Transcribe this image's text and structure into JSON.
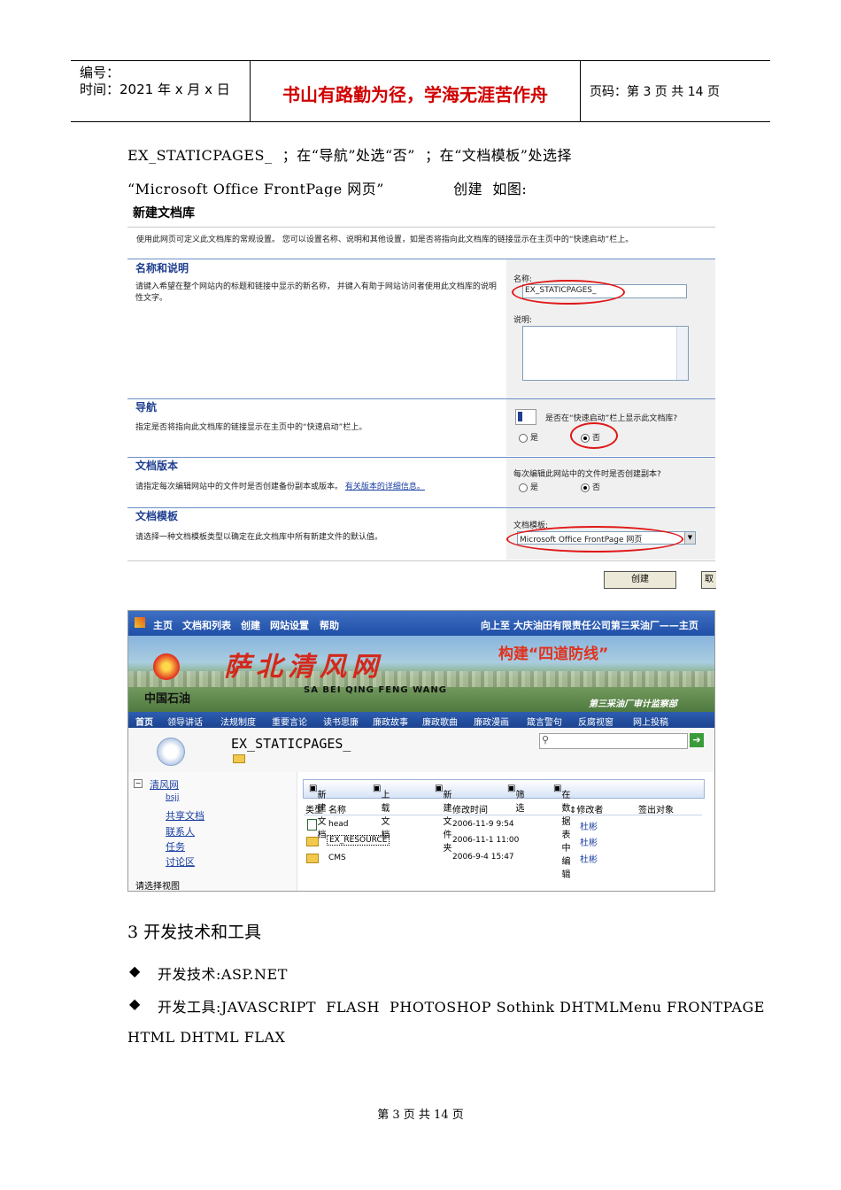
{
  "header": {
    "number_label": "编号：",
    "time_label": "时间：2021 年 x 月 x 日",
    "motto": "书山有路勤为径，学海无涯苦作舟",
    "page_label": "页码：第 3 页  共 14 页"
  },
  "intro": {
    "line1": "EX_STATICPAGES_  ；在“导航”处选“否”  ；在“文档模板”处选择",
    "line2": "“Microsoft Office FrontPage 网页”              创建  如图:"
  },
  "shot1": {
    "title": "新建文档库",
    "desc": "使用此网页可定义此文档库的常规设置。 您可以设置名称、说明和其他设置，如是否将指向此文档库的链接显示在主页中的“快速启动”栏上。",
    "sec1_title": "名称和说明",
    "sec1_desc": "请键入希望在整个网站内的标题和链接中显示的新名称， 并键入有助于网站访问者使用此文档库的说明性文字。",
    "name_label": "名称:",
    "name_value": "EX_STATICPAGES_",
    "desc_label": "说明:",
    "sec2_title": "导航",
    "sec2_desc": "指定是否将指向此文档库的链接显示在主页中的“快速启动”栏上。",
    "nav_question": "是否在“快速启动”栏上显示此文档库?",
    "yes": "是",
    "no": "否",
    "sec3_title": "文档版本",
    "sec3_desc": "请指定每次编辑网站中的文件时是否创建备份副本或版本。",
    "sec3_link": "有关版本的详细信息。",
    "version_question": "每次编辑此网站中的文件时是否创建副本?",
    "sec4_title": "文档模板",
    "sec4_desc": "请选择一种文档模板类型以确定在此文档库中所有新建文件的默认值。",
    "template_label": "文档模板:",
    "template_value": "Microsoft Office FrontPage 网页",
    "create_button": "创建",
    "cancel_button": "取"
  },
  "shot2": {
    "topnav": [
      "主页",
      "文档和列表",
      "创建",
      "网站设置",
      "帮助"
    ],
    "topright": "向上至  大庆油田有限责任公司第三采油厂——主页",
    "banner_title": "萨北清风网",
    "banner_slogan": "构建“四道防线”",
    "banner_pinyin": "SA BEI QING FENG WANG",
    "banner_logo": "中国石油",
    "banner_org": "第三采油厂审计监察部",
    "navitems": [
      "首页",
      "领导讲话",
      "法规制度",
      "重要言论",
      "读书思廉",
      "廉政故事",
      "廉政歌曲",
      "廉政漫画",
      "箴言警句",
      "反腐视窗",
      "网上投稿"
    ],
    "lib_title": "EX_STATICPAGES_",
    "tree": [
      "清风网",
      "bsjj",
      "共享文档",
      "联系人",
      "任务",
      "讨论区"
    ],
    "select_view": "请选择视图",
    "toolbar": [
      "新建文档",
      "上载文档",
      "新建文件夹",
      "筛选",
      "在数据表中编辑"
    ],
    "columns": [
      "类型",
      "名称",
      "修改时间",
      "修改者",
      "签出对象"
    ],
    "rows": [
      {
        "name": "head",
        "time": "2006-11-9 9:54",
        "by": "杜彬"
      },
      {
        "name": "EX_RESOURCE",
        "time": "2006-11-1 11:00",
        "by": "杜彬"
      },
      {
        "name": "CMS",
        "time": "2006-9-4 15:47",
        "by": "杜彬"
      }
    ]
  },
  "section": {
    "heading": "3 开发技术和工具",
    "bullet1": "开发技术:ASP.NET",
    "bullet2": "开发工具:JAVASCRIPT  FLASH  PHOTOSHOP Sothink DHTMLMenu FRONTPAGE",
    "bullet2_cont": "HTML DHTML FLAX"
  },
  "footer": "第 3 页 共 14 页"
}
